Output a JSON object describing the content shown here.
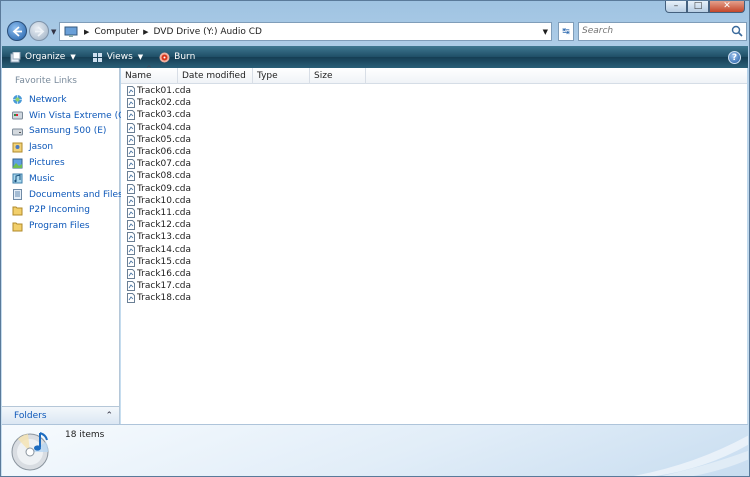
{
  "window": {
    "controls": {
      "minimize": "–",
      "maximize": "□",
      "close": "✕"
    }
  },
  "address": {
    "crumbs": [
      "Computer",
      "DVD Drive (Y:) Audio CD"
    ]
  },
  "search": {
    "placeholder": "Search"
  },
  "toolbar": {
    "organize": "Organize",
    "views": "Views",
    "burn": "Burn",
    "help": "?"
  },
  "navpane": {
    "title": "Favorite Links",
    "items": [
      {
        "label": "Network",
        "icon": "network-icon"
      },
      {
        "label": "Win Vista Extreme (C)",
        "icon": "drive-icon"
      },
      {
        "label": "Samsung 500 (E)",
        "icon": "drive-icon"
      },
      {
        "label": "Jason",
        "icon": "user-folder-icon"
      },
      {
        "label": "Pictures",
        "icon": "pictures-icon"
      },
      {
        "label": "Music",
        "icon": "music-icon"
      },
      {
        "label": "Documents and Files",
        "icon": "documents-icon"
      },
      {
        "label": "P2P Incoming",
        "icon": "folder-icon"
      },
      {
        "label": "Program Files",
        "icon": "folder-icon"
      }
    ],
    "folders_label": "Folders",
    "folders_chevron": "⌃"
  },
  "columns": {
    "name": "Name",
    "date": "Date modified",
    "type": "Type",
    "size": "Size"
  },
  "files": [
    "Track01.cda",
    "Track02.cda",
    "Track03.cda",
    "Track04.cda",
    "Track05.cda",
    "Track06.cda",
    "Track07.cda",
    "Track08.cda",
    "Track09.cda",
    "Track10.cda",
    "Track11.cda",
    "Track12.cda",
    "Track13.cda",
    "Track14.cda",
    "Track15.cda",
    "Track16.cda",
    "Track17.cda",
    "Track18.cda"
  ],
  "details": {
    "count": "18 items"
  },
  "colors": {
    "link": "#0e58b9",
    "toolbar": "#1f4e66"
  }
}
